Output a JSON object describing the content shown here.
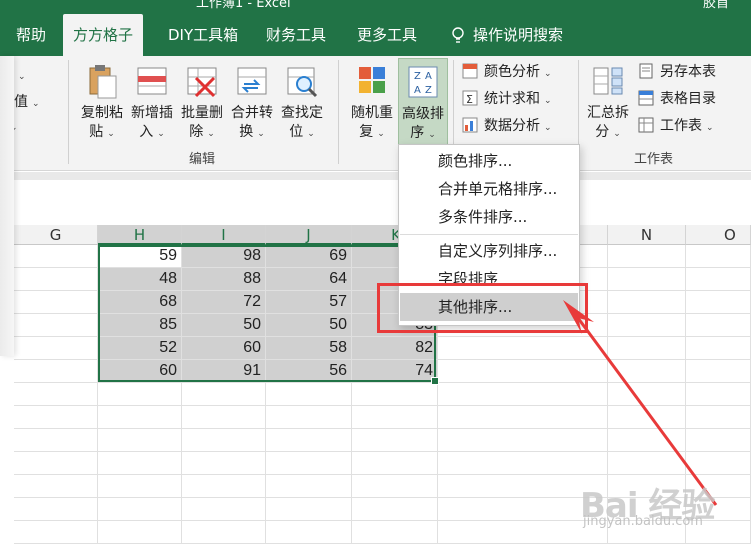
{
  "window": {
    "title": "工作簿1 - Excel",
    "user_partial": "胶首"
  },
  "tabs": [
    {
      "label": "帮助",
      "active": false
    },
    {
      "label": "方方格子",
      "active": true
    },
    {
      "label": "DIY工具箱",
      "active": false
    },
    {
      "label": "财务工具",
      "active": false
    },
    {
      "label": "更多工具",
      "active": false
    },
    {
      "label": "操作说明搜索",
      "active": false,
      "icon": "lightbulb-icon"
    }
  ],
  "ribbon": {
    "left_partial": [
      "入",
      "数值",
      ""
    ],
    "big_buttons": [
      {
        "label1": "复制粘",
        "label2": "贴",
        "icon": "paste-icon"
      },
      {
        "label1": "新增插",
        "label2": "入",
        "icon": "insert-icon"
      },
      {
        "label1": "批量删",
        "label2": "除",
        "icon": "delete-icon"
      },
      {
        "label1": "合并转",
        "label2": "换",
        "icon": "merge-convert-icon"
      },
      {
        "label1": "查找定",
        "label2": "位",
        "icon": "find-icon"
      },
      {
        "label1": "随机重",
        "label2": "复",
        "icon": "random-icon"
      },
      {
        "label1": "高级排",
        "label2": "序",
        "icon": "sort-az-icon"
      }
    ],
    "small_buttons": [
      {
        "label": "颜色分析",
        "icon": "color-analysis-icon"
      },
      {
        "label": "统计求和",
        "icon": "sum-icon"
      },
      {
        "label": "数据分析",
        "icon": "data-analysis-icon"
      }
    ],
    "summary_button": {
      "label1": "汇总拆",
      "label2": "分",
      "icon": "split-icon"
    },
    "worksheet_buttons": [
      {
        "label": "另存本表",
        "icon": "save-sheet-icon"
      },
      {
        "label": "表格目录",
        "icon": "catalog-icon"
      },
      {
        "label": "工作表",
        "icon": "worksheet-icon"
      }
    ],
    "group_labels": [
      "编辑",
      "工作表"
    ]
  },
  "columns": [
    {
      "label": "G",
      "selected": false
    },
    {
      "label": "H",
      "selected": true
    },
    {
      "label": "I",
      "selected": true
    },
    {
      "label": "J",
      "selected": true
    },
    {
      "label": "K",
      "selected": true
    },
    {
      "label": "N",
      "selected": false
    },
    {
      "label": "O",
      "selected": false
    }
  ],
  "rows": [
    [
      59,
      98,
      69,
      ""
    ],
    [
      48,
      88,
      64,
      ""
    ],
    [
      68,
      72,
      57,
      ""
    ],
    [
      85,
      50,
      50,
      83
    ],
    [
      52,
      60,
      58,
      82
    ],
    [
      60,
      91,
      56,
      74
    ]
  ],
  "dropdown": {
    "items": [
      "颜色排序...",
      "合并单元格排序...",
      "多条件排序...",
      "自定义序列排序...",
      "字段排序",
      "其他排序..."
    ],
    "highlighted": "其他排序..."
  },
  "watermark": {
    "brand": "Bai 经验",
    "url": "jingyan.baidu.com"
  },
  "colors": {
    "excel_green": "#217346",
    "annotation_red": "#e83a3a"
  }
}
